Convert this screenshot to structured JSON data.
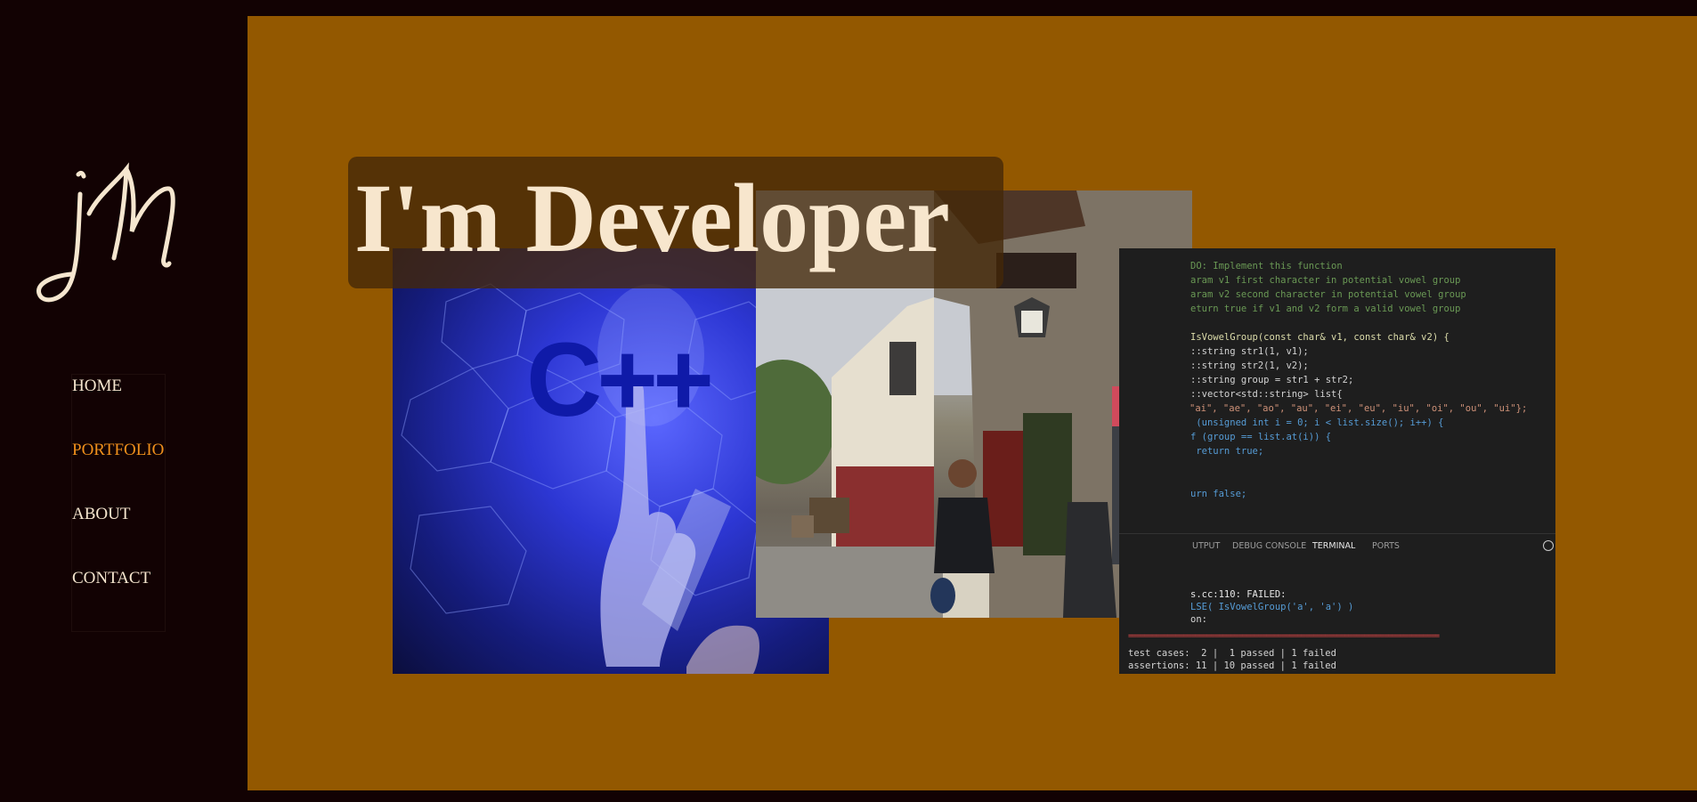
{
  "sidebar": {
    "logo_text": "jm",
    "nav": [
      {
        "label": "HOME",
        "active": false
      },
      {
        "label": "PORTFOLIO",
        "active": true
      },
      {
        "label": "ABOUT",
        "active": false
      },
      {
        "label": "CONTACT",
        "active": false
      }
    ]
  },
  "hero": {
    "title": "I'm Developer"
  },
  "images": {
    "cpp": {
      "icon": "cpp-finger-touch-image",
      "text": "C++"
    },
    "street": {
      "icon": "street-photo-person"
    },
    "code": {
      "icon": "vscode-terminal-screenshot"
    }
  },
  "code": {
    "lines": [
      "DO: Implement this function",
      "aram v1 first character in potential vowel group",
      "aram v2 second character in potential vowel group",
      "eturn true if v1 and v2 form a valid vowel group",
      "",
      "IsVowelGroup(const char& v1, const char& v2) {",
      "::string str1(1, v1);",
      "::string str2(1, v2);",
      "::string group = str1 + str2;",
      "::vector<std::string> list{",
      "\"ai\", \"ae\", \"ao\", \"au\", \"ei\", \"eu\", \"iu\", \"oi\", \"ou\", \"ui\"};",
      " (unsigned int i = 0; i < list.size(); i++) {",
      "f (group == list.at(i)) {",
      " return true;",
      "",
      "",
      "urn false;"
    ],
    "tabs": [
      "UTPUT",
      "DEBUG CONSOLE",
      "TERMINAL",
      "PORTS"
    ],
    "active_tab": "TERMINAL",
    "terminal": [
      "s.cc:110: FAILED:",
      "LSE( IsVowelGroup('a', 'a') )",
      "on:",
      "",
      "",
      "test cases:  2 |  1 passed | 1 failed",
      "assertions: 11 | 10 passed | 1 failed"
    ],
    "separator": "===============================================================================",
    "colors": {
      "comment": "#6a9955",
      "keyword": "#569cd6",
      "string": "#ce9178",
      "function": "#dcdcaa",
      "failed": "#f14c4c",
      "passed": "#23d18b"
    }
  },
  "colors": {
    "sidebar_bg": "#120203",
    "main_bg": "#935800",
    "nav_text": "#f5e6cf",
    "nav_active": "#f0901c",
    "headline": "#f7e6cd"
  }
}
